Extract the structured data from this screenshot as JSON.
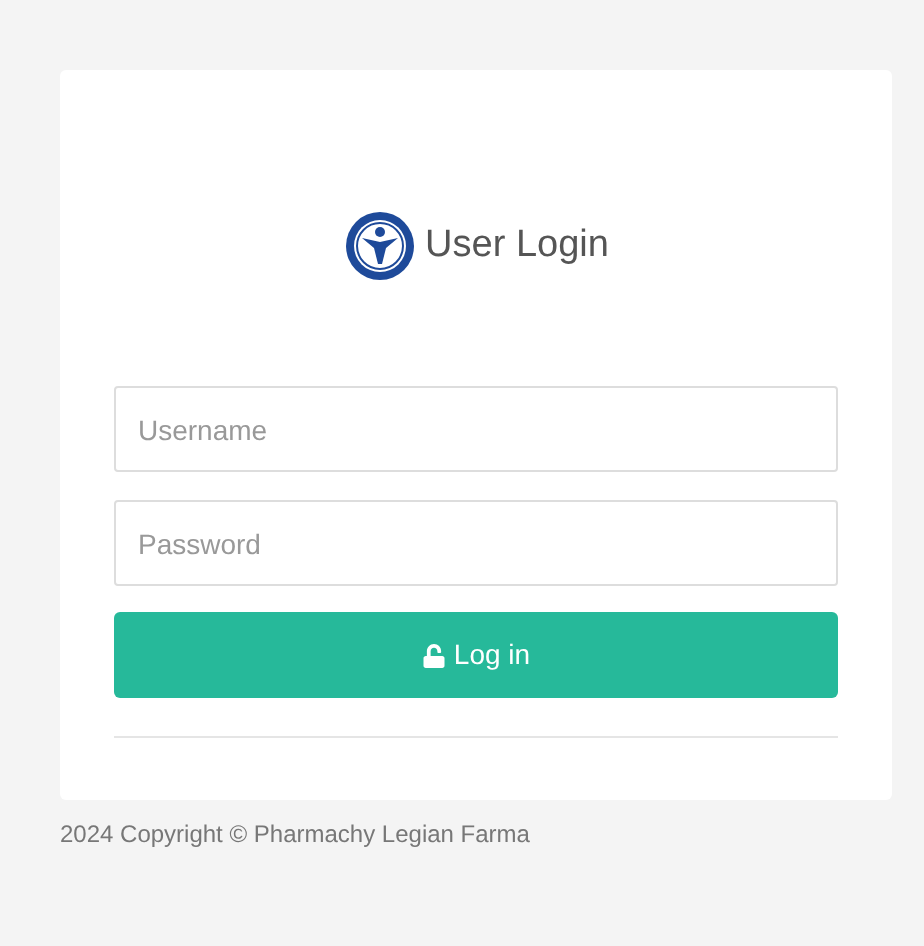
{
  "login": {
    "title": "User Login",
    "username": {
      "placeholder": "Username"
    },
    "password": {
      "placeholder": "Password"
    },
    "button": "Log in"
  },
  "footer": "2024 Copyright © Pharmachy Legian Farma"
}
